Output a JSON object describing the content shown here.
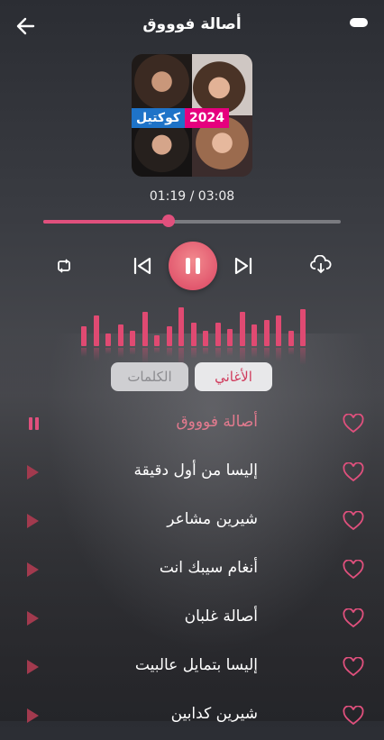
{
  "header": {
    "title": "أصالة فوووق"
  },
  "cover": {
    "year": "2024",
    "label": "كوكتيل"
  },
  "player": {
    "current_time": "01:19",
    "total_time": "03:08",
    "time_display": "01:19 / 03:08",
    "progress_fraction": 0.42
  },
  "equalizer": [
    0.45,
    0.7,
    0.3,
    0.5,
    0.35,
    0.8,
    0.25,
    0.45,
    0.9,
    0.55,
    0.35,
    0.55,
    0.4,
    0.8,
    0.5,
    0.6,
    0.7,
    0.35,
    0.85
  ],
  "tabs": {
    "songs": "الأغاني",
    "lyrics": "الكلمات"
  },
  "colors": {
    "accent": "#e0507d",
    "active_text": "#e27a8e"
  },
  "songs": [
    {
      "title": "أصالة فوووق",
      "playing": true
    },
    {
      "title": "إليسا من أول دقيقة",
      "playing": false
    },
    {
      "title": "شيرين مشاعر",
      "playing": false
    },
    {
      "title": "أنغام سيبك انت",
      "playing": false
    },
    {
      "title": "أصالة غلبان",
      "playing": false
    },
    {
      "title": "إليسا بتمايل عالبيت",
      "playing": false
    },
    {
      "title": "شيرين كدابين",
      "playing": false
    }
  ]
}
